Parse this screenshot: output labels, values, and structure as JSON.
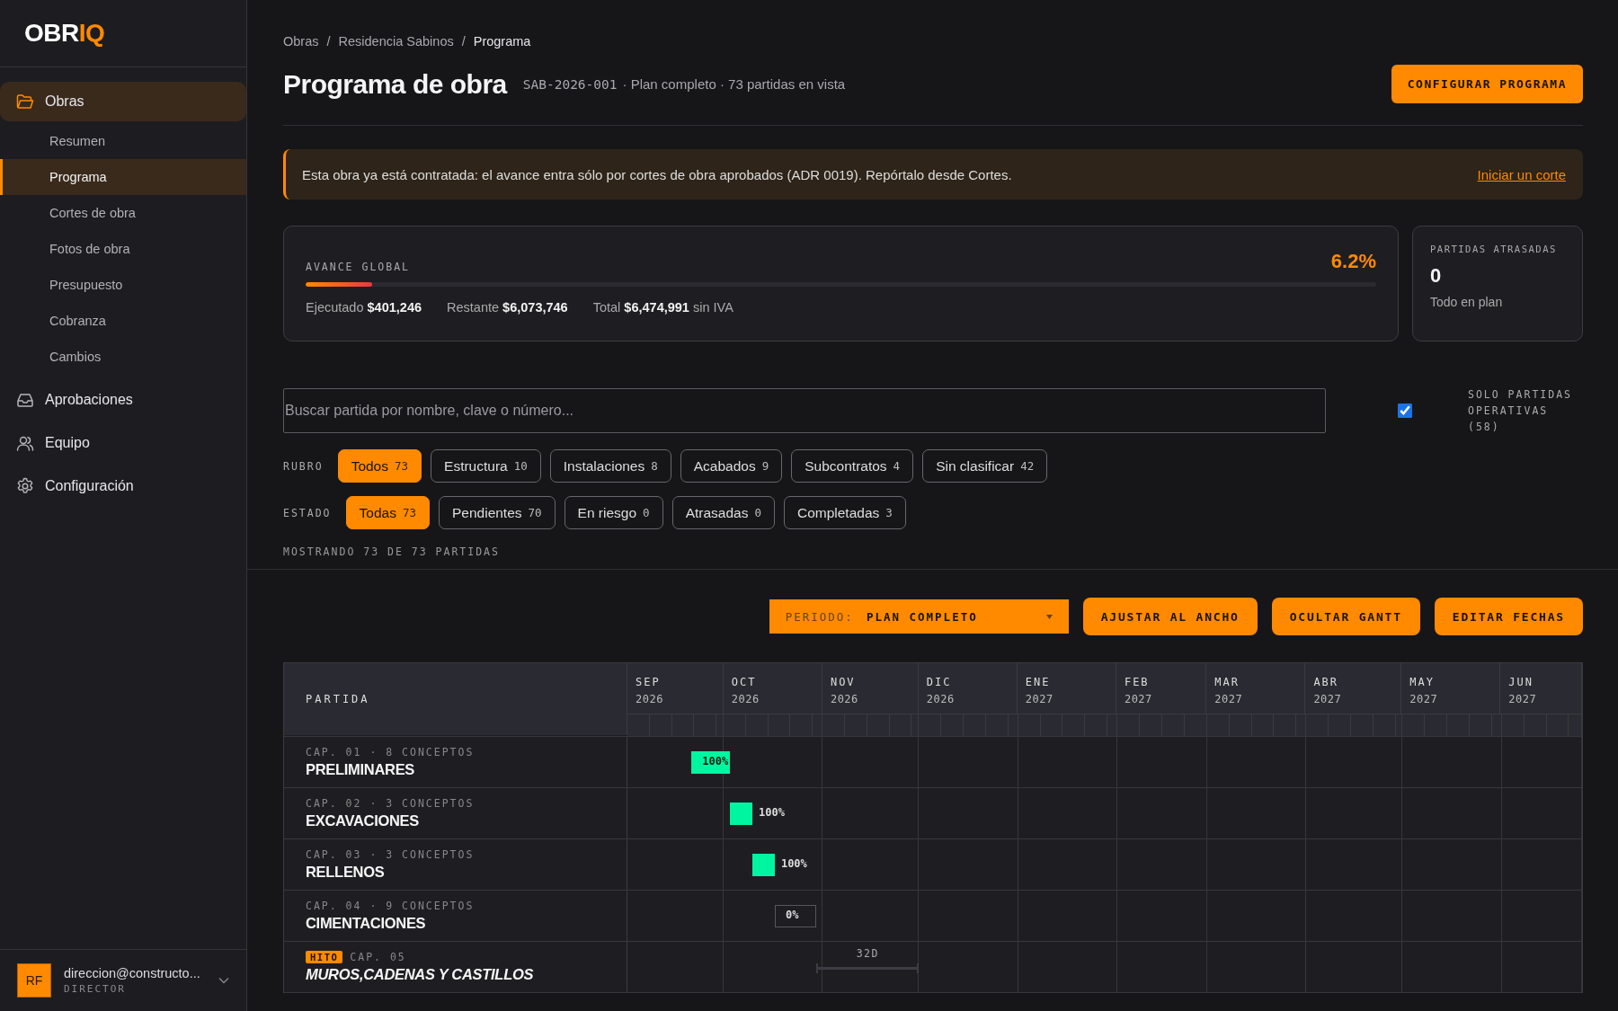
{
  "sidebar": {
    "logo": {
      "primary": "OBR",
      "accent": "IQ"
    },
    "nav": [
      {
        "label": "Obras",
        "selected": true,
        "children": [
          {
            "label": "Resumen",
            "selected": false
          },
          {
            "label": "Programa",
            "selected": true
          },
          {
            "label": "Cortes de obra",
            "selected": false
          },
          {
            "label": "Fotos de obra",
            "selected": false
          },
          {
            "label": "Presupuesto",
            "selected": false
          },
          {
            "label": "Cobranza",
            "selected": false
          },
          {
            "label": "Cambios",
            "selected": false
          }
        ]
      },
      {
        "label": "Aprobaciones",
        "selected": false
      },
      {
        "label": "Equipo",
        "selected": false
      },
      {
        "label": "Configuración",
        "selected": false
      }
    ],
    "user": {
      "initials": "RF",
      "email": "direccion@constructo...",
      "role": "DIRECTOR"
    }
  },
  "breadcrumb": [
    {
      "kind": "link",
      "label": "Obras"
    },
    {
      "kind": "separator",
      "label": "/"
    },
    {
      "kind": "link",
      "label": "Residencia Sabinos"
    },
    {
      "kind": "separator",
      "label": "/"
    },
    {
      "kind": "current",
      "label": "Programa"
    }
  ],
  "header": {
    "title": "Programa de obra",
    "code": "SAB-2026-001",
    "subtitle": "· Plan completo · 73 partidas en vista",
    "button": "CONFIGURAR PROGRAMA"
  },
  "banner": {
    "text": "Esta obra ya está contratada: el avance entra sólo por cortes de obra aprobados (ADR 0019). Repórtalo desde Cortes.",
    "link": "Iniciar un corte"
  },
  "progress": {
    "label": "AVANCE GLOBAL",
    "reading": "6.2%",
    "level": 0.062,
    "figures": [
      "Ejecutado **$401,246**",
      "Restante **$6,073,746**",
      "Total **$6,474,991** sin IVA"
    ]
  },
  "late": {
    "label": "PARTIDAS ATRASADAS",
    "value": "0",
    "note": "Todo en plan"
  },
  "search": {
    "placeholder": "Buscar partida por nombre, clave o número..."
  },
  "operativas": {
    "label": "SOLO PARTIDAS OPERATIVAS (58)",
    "checked": true
  },
  "filters": [
    {
      "label": "RUBRO",
      "chips": [
        {
          "label": "Todos",
          "count": "73",
          "selected": true
        },
        {
          "label": "Estructura",
          "count": "10",
          "selected": false
        },
        {
          "label": "Instalaciones",
          "count": "8",
          "selected": false
        },
        {
          "label": "Acabados",
          "count": "9",
          "selected": false
        },
        {
          "label": "Subcontratos",
          "count": "4",
          "selected": false
        },
        {
          "label": "Sin clasificar",
          "count": "42",
          "selected": false
        }
      ]
    },
    {
      "label": "ESTADO",
      "chips": [
        {
          "label": "Todas",
          "count": "73",
          "selected": true
        },
        {
          "label": "Pendientes",
          "count": "70",
          "selected": false
        },
        {
          "label": "En riesgo",
          "count": "0",
          "selected": false
        },
        {
          "label": "Atrasadas",
          "count": "0",
          "selected": false
        },
        {
          "label": "Completadas",
          "count": "3",
          "selected": false
        }
      ]
    }
  ],
  "showing": "MOSTRANDO 73 DE 73 PARTIDAS",
  "toolbar": {
    "period": {
      "label": "PERIODO:",
      "value": "PLAN COMPLETO"
    },
    "buttons": [
      "AJUSTAR AL ANCHO",
      "OCULTAR GANTT",
      "EDITAR FECHAS"
    ]
  },
  "gantt": {
    "column": "PARTIDA",
    "months": [
      {
        "month": "SEP",
        "year": "2026"
      },
      {
        "month": "OCT",
        "year": "2026"
      },
      {
        "month": "NOV",
        "year": "2026"
      },
      {
        "month": "DIC",
        "year": "2026"
      },
      {
        "month": "ENE",
        "year": "2027"
      },
      {
        "month": "FEB",
        "year": "2027"
      },
      {
        "month": "MAR",
        "year": "2027"
      },
      {
        "month": "ABR",
        "year": "2027"
      },
      {
        "month": "MAY",
        "year": "2027"
      },
      {
        "month": "JUN",
        "year": "2027"
      }
    ],
    "rows": [
      {
        "kind": "chapter",
        "meta": "CAP. 01 · 8 CONCEPTOS",
        "name": "PRELIMINARES",
        "completed": true,
        "reading": "100%"
      },
      {
        "kind": "chapter",
        "meta": "CAP. 02 · 3 CONCEPTOS",
        "name": "EXCAVACIONES",
        "completed": true,
        "reading": "100%"
      },
      {
        "kind": "chapter",
        "meta": "CAP. 03 · 3 CONCEPTOS",
        "name": "RELLENOS",
        "completed": true,
        "reading": "100%"
      },
      {
        "kind": "chapter",
        "meta": "CAP. 04 · 9 CONCEPTOS",
        "name": "CIMENTACIONES",
        "completed": false,
        "reading": "0%"
      },
      {
        "kind": "milestone",
        "badge": "HITO",
        "meta": "CAP. 05",
        "name": "MUROS,CADENAS Y CASTILLOS",
        "duration": "32D"
      }
    ]
  }
}
